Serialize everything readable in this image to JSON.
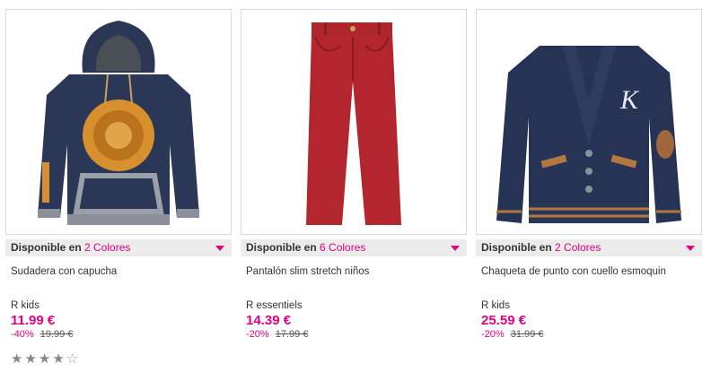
{
  "products": [
    {
      "availability_prefix": "Disponible en",
      "colors_label": "2 Colores",
      "name": "Sudadera con capucha",
      "brand": "R kids",
      "price": "11.99 €",
      "discount": "-40%",
      "old_price": "19.99 €",
      "rating": 4,
      "rating_max": 5,
      "image_icon": "hoodie-image"
    },
    {
      "availability_prefix": "Disponible en",
      "colors_label": "6 Colores",
      "name": "Pantalón slim stretch niños",
      "brand": "R essentiels",
      "price": "14.39 €",
      "discount": "-20%",
      "old_price": "17.99 €",
      "image_icon": "trousers-image"
    },
    {
      "availability_prefix": "Disponible en",
      "colors_label": "2 Colores",
      "name": "Chaqueta de punto con cuello esmoquin",
      "brand": "R kids",
      "price": "25.59 €",
      "discount": "-20%",
      "old_price": "31.99 €",
      "image_icon": "cardigan-image"
    }
  ],
  "colors": {
    "accent": "#e6007e",
    "availability_bar": "#ececec",
    "star": "#7f8a8c"
  }
}
